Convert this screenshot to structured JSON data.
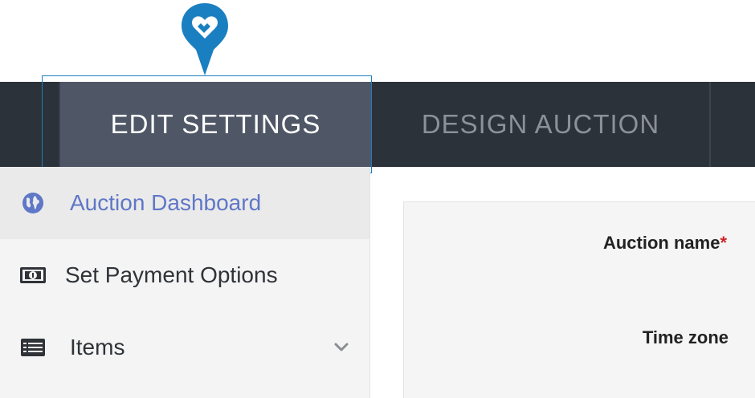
{
  "tabs": {
    "edit_settings": "EDIT SETTINGS",
    "design_auction": "DESIGN AUCTION"
  },
  "sidebar": {
    "items": [
      {
        "label": "Auction Dashboard",
        "icon": "globe-icon",
        "active": true
      },
      {
        "label": "Set Payment Options",
        "icon": "money-icon"
      },
      {
        "label": "Items",
        "icon": "list-icon",
        "expandable": true
      }
    ]
  },
  "form": {
    "auction_name_label": "Auction name",
    "required_marker": "*",
    "time_zone_label": "Time zone"
  },
  "colors": {
    "nav_bg": "#2c323a",
    "active_tab": "#4f5766",
    "highlight": "#1e7fc0",
    "active_link": "#5f77c7",
    "pin": "#1a7fc1"
  }
}
